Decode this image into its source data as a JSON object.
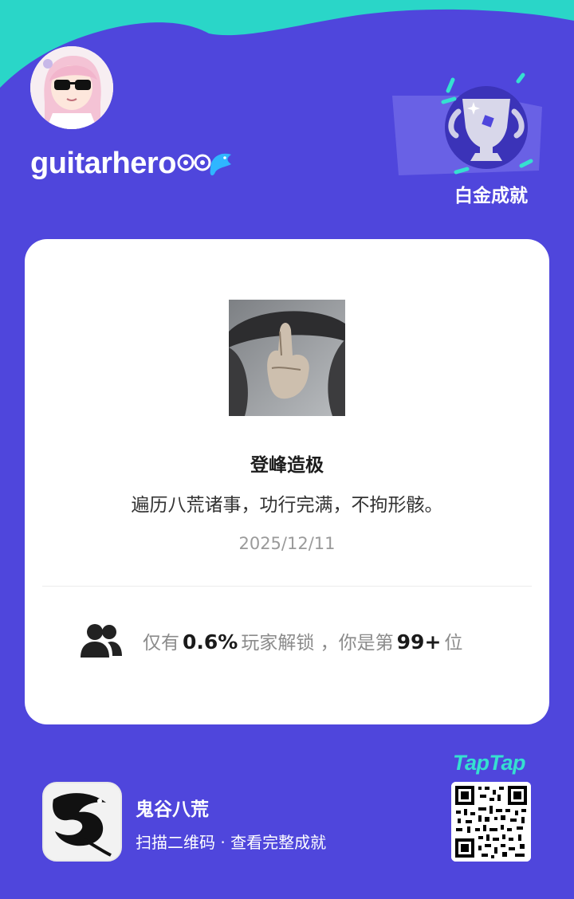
{
  "header": {
    "username": "guitarhero",
    "tier_label": "白金成就"
  },
  "achievement": {
    "title": "登峰造极",
    "description": "遍历八荒诸事，功行完满，不拘形骸。",
    "date": "2025/12/11"
  },
  "stats": {
    "prefix": "仅有",
    "percent": "0.6%",
    "middle": "玩家解锁 ，你是第",
    "rank": "99+",
    "suffix": "位"
  },
  "footer": {
    "game_name": "鬼谷八荒",
    "scan_hint": "扫描二维码 · 查看完整成就",
    "brand": "TapTap"
  },
  "colors": {
    "background": "#4f46dc",
    "wave": "#2ad6c8",
    "brand": "#35e0d0"
  }
}
